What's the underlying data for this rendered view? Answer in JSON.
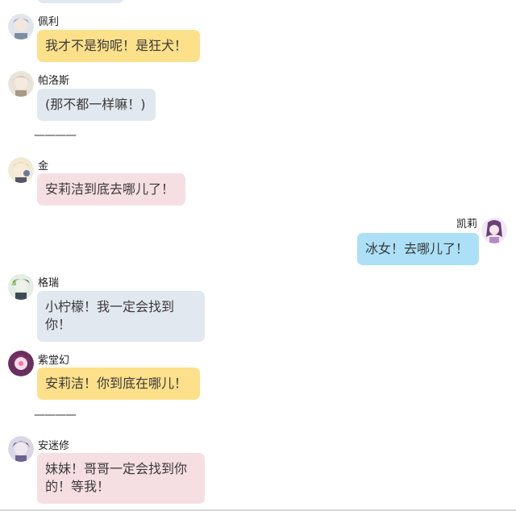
{
  "messages": [
    {
      "id": "peili",
      "name": "佩利",
      "text": "我才不是狗呢！是狂犬！",
      "color": "#fde08a"
    },
    {
      "id": "paluosi",
      "name": "帕洛斯",
      "text": "(那不都一样嘛！)",
      "color": "#e2e8f0"
    },
    {
      "id": "jin",
      "name": "金",
      "text": "安莉洁到底去哪儿了！",
      "color": "#f6dfe3"
    },
    {
      "id": "kaili",
      "name": "凯莉",
      "text": "冰女！去哪儿了！",
      "color": "#ace0f7"
    },
    {
      "id": "gerui",
      "name": "格瑞",
      "text": "小柠檬！我一定会找到你！",
      "color": "#e2e8f0"
    },
    {
      "id": "zitanghuan",
      "name": "紫堂幻",
      "text": "安莉洁！你到底在哪儿！",
      "color": "#fde08a"
    },
    {
      "id": "anmixiu",
      "name": "安迷修",
      "text": "妹妹！哥哥一定会找到你的！等我！",
      "color": "#f6dfe3"
    }
  ],
  "dividers": [
    "————",
    "————"
  ]
}
